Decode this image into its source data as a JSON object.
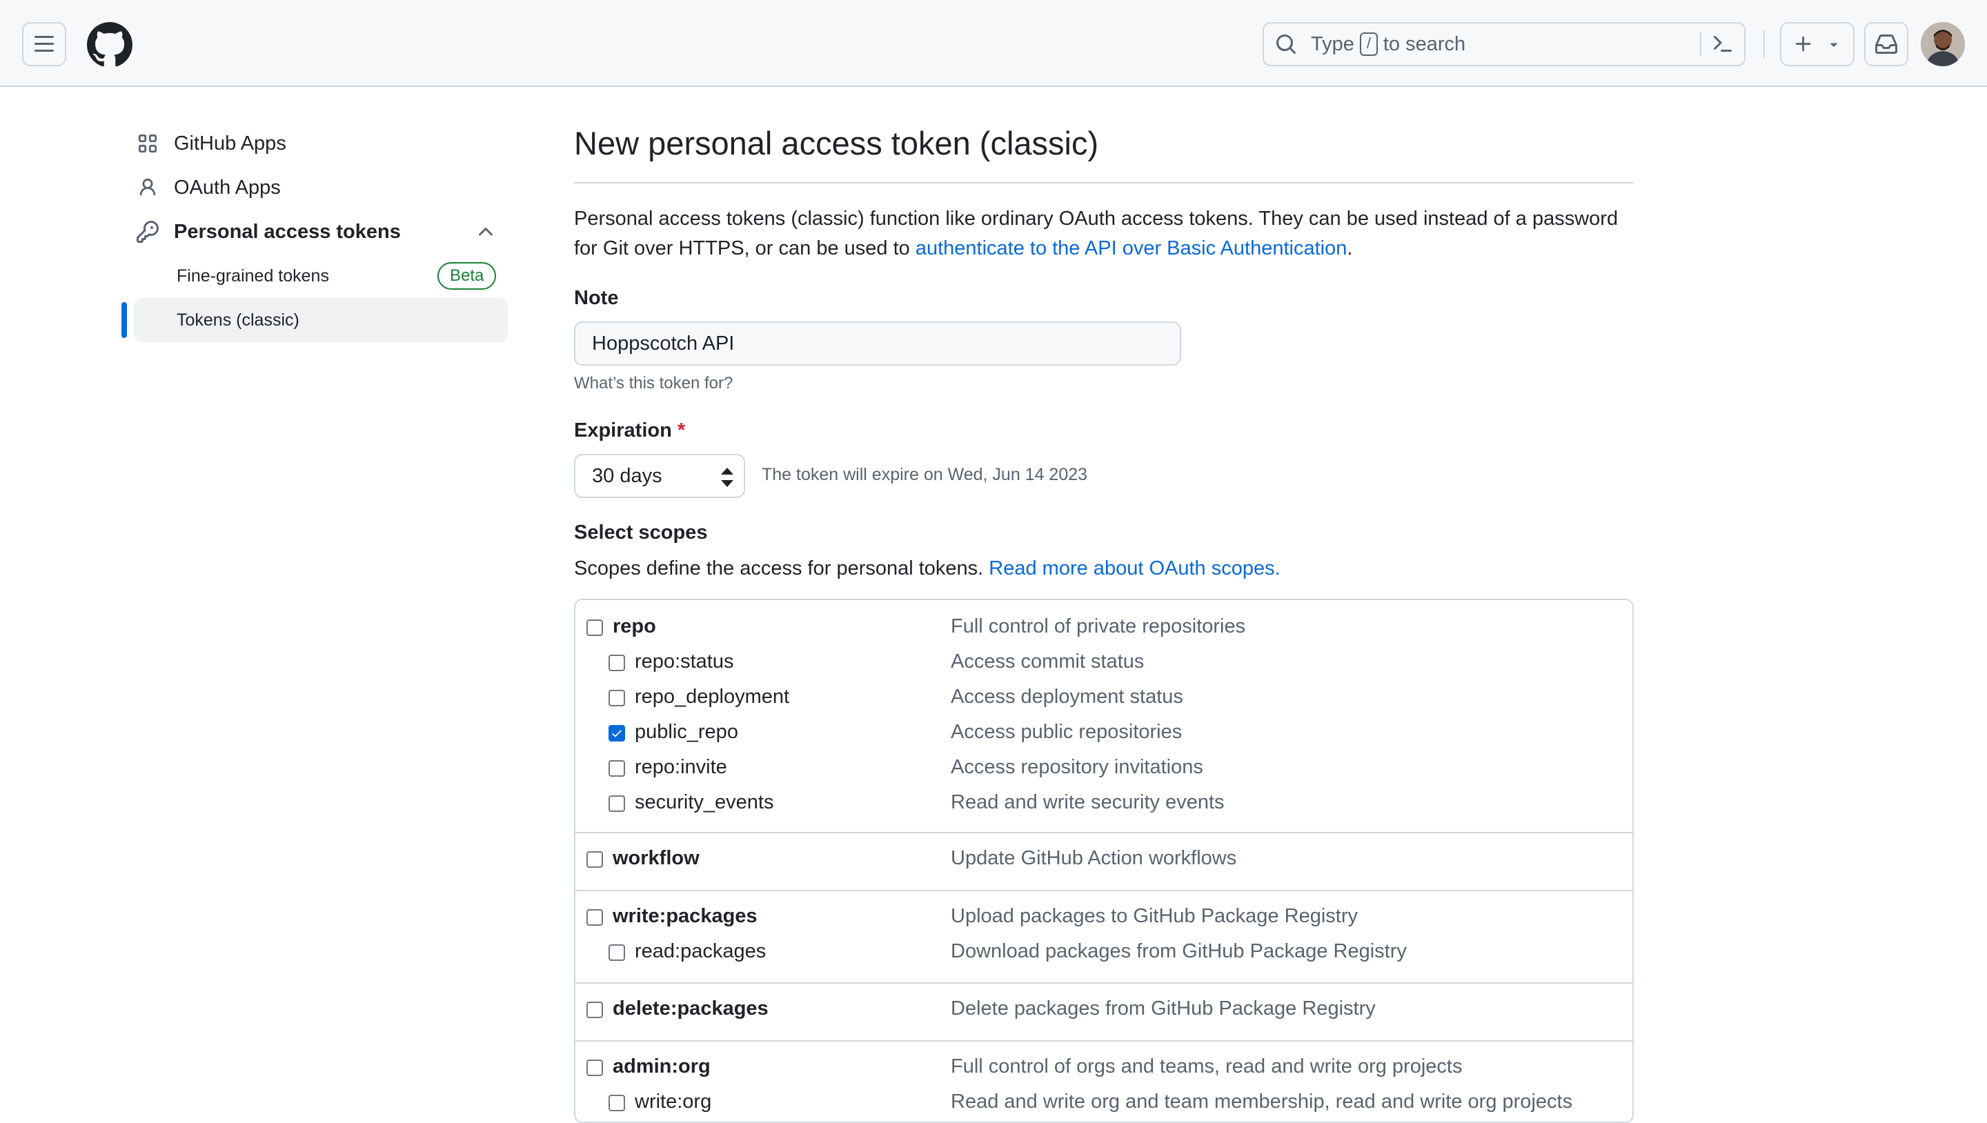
{
  "header": {
    "search_before": "Type",
    "search_key": "/",
    "search_after": "to search"
  },
  "sidebar": {
    "items": [
      {
        "label": "GitHub Apps",
        "icon": "apps-grid-icon"
      },
      {
        "label": "OAuth Apps",
        "icon": "person-icon"
      },
      {
        "label": "Personal access tokens",
        "icon": "key-icon",
        "expanded": true
      }
    ],
    "subitems": [
      {
        "label": "Fine-grained tokens",
        "badge": "Beta"
      },
      {
        "label": "Tokens (classic)",
        "active": true
      }
    ]
  },
  "main": {
    "title": "New personal access token (classic)",
    "intro_text": "Personal access tokens (classic) function like ordinary OAuth access tokens. They can be used instead of a password for Git over HTTPS, or can be used to ",
    "intro_link": "authenticate to the API over Basic Authentication",
    "intro_end": ".",
    "note_label": "Note",
    "note_value": "Hoppscotch API",
    "note_hint": "What’s this token for?",
    "expiration_label": "Expiration",
    "expiration_required": "*",
    "expiration_value": "30 days",
    "expiration_text": "The token will expire on Wed, Jun 14 2023",
    "scopes_label": "Select scopes",
    "scopes_desc": "Scopes define the access for personal tokens. ",
    "scopes_link": "Read more about OAuth scopes."
  },
  "scopes": [
    {
      "name": "repo",
      "desc": "Full control of private repositories",
      "parent": true,
      "checked": false
    },
    {
      "name": "repo:status",
      "desc": "Access commit status",
      "parent": false,
      "checked": false
    },
    {
      "name": "repo_deployment",
      "desc": "Access deployment status",
      "parent": false,
      "checked": false
    },
    {
      "name": "public_repo",
      "desc": "Access public repositories",
      "parent": false,
      "checked": true
    },
    {
      "name": "repo:invite",
      "desc": "Access repository invitations",
      "parent": false,
      "checked": false
    },
    {
      "name": "security_events",
      "desc": "Read and write security events",
      "parent": false,
      "checked": false
    },
    {
      "name": "workflow",
      "desc": "Update GitHub Action workflows",
      "parent": true,
      "checked": false
    },
    {
      "name": "write:packages",
      "desc": "Upload packages to GitHub Package Registry",
      "parent": true,
      "checked": false
    },
    {
      "name": "read:packages",
      "desc": "Download packages from GitHub Package Registry",
      "parent": false,
      "checked": false
    },
    {
      "name": "delete:packages",
      "desc": "Delete packages from GitHub Package Registry",
      "parent": true,
      "checked": false
    },
    {
      "name": "admin:org",
      "desc": "Full control of orgs and teams, read and write org projects",
      "parent": true,
      "checked": false
    },
    {
      "name": "write:org",
      "desc": "Read and write org and team membership, read and write org projects",
      "parent": false,
      "checked": false
    }
  ],
  "colors": {
    "accent": "#0969da",
    "success": "#1a7f37",
    "danger": "#d1242f",
    "border": "#d0d7de",
    "muted": "#59636e"
  }
}
